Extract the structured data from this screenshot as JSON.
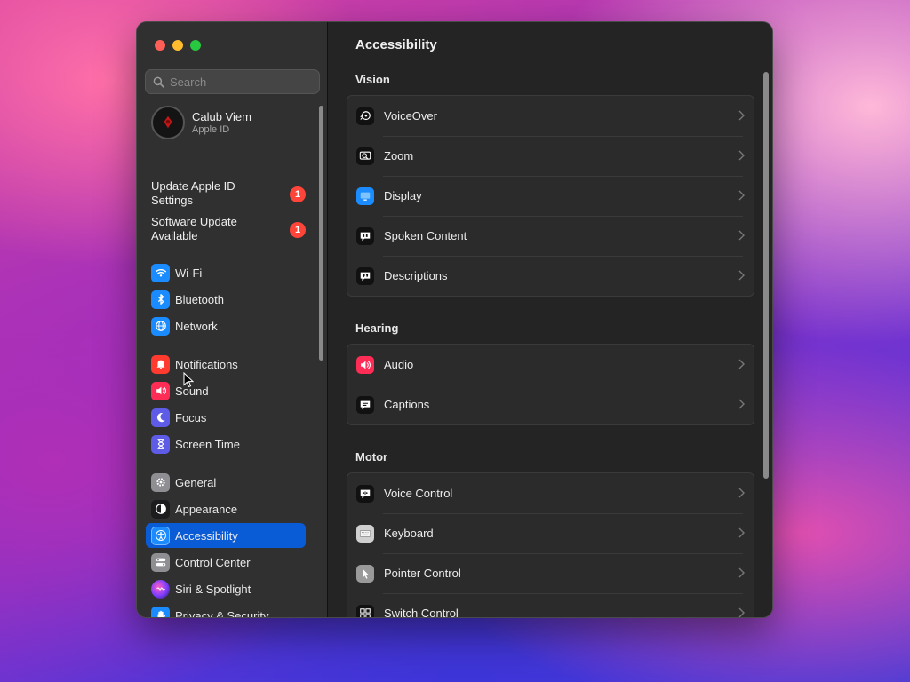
{
  "search": {
    "placeholder": "Search"
  },
  "account": {
    "name": "Calub Viem",
    "subtitle": "Apple ID"
  },
  "alerts": [
    {
      "label": "Update Apple ID Settings",
      "badge": "1"
    },
    {
      "label": "Software Update Available",
      "badge": "1"
    }
  ],
  "sidebar": {
    "items": [
      {
        "label": "Wi-Fi",
        "icon": "wifi-icon",
        "color": "#1a8cff"
      },
      {
        "label": "Bluetooth",
        "icon": "bluetooth-icon",
        "color": "#1a8cff"
      },
      {
        "label": "Network",
        "icon": "globe-icon",
        "color": "#1a8cff"
      },
      {
        "label": "Notifications",
        "icon": "bell-icon",
        "color": "#ff3b30"
      },
      {
        "label": "Sound",
        "icon": "speaker-icon",
        "color": "#ff2d55"
      },
      {
        "label": "Focus",
        "icon": "moon-icon",
        "color": "#5e5ce6"
      },
      {
        "label": "Screen Time",
        "icon": "hourglass-icon",
        "color": "#5e5ce6"
      },
      {
        "label": "General",
        "icon": "gear-icon",
        "color": "#8e8e93"
      },
      {
        "label": "Appearance",
        "icon": "appearance-icon",
        "color": "#1c1c1e"
      },
      {
        "label": "Accessibility",
        "icon": "accessibility-icon",
        "color": "#1a8cff",
        "selected": true
      },
      {
        "label": "Control Center",
        "icon": "toggles-icon",
        "color": "#8e8e93"
      },
      {
        "label": "Siri & Spotlight",
        "icon": "siri-icon",
        "color": "#bf5af2"
      },
      {
        "label": "Privacy & Security",
        "icon": "hand-icon",
        "color": "#1a8cff"
      }
    ]
  },
  "main": {
    "title": "Accessibility",
    "sections": [
      {
        "heading": "Vision",
        "rows": [
          {
            "label": "VoiceOver",
            "icon": "voiceover-icon"
          },
          {
            "label": "Zoom",
            "icon": "zoom-icon"
          },
          {
            "label": "Display",
            "icon": "display-icon"
          },
          {
            "label": "Spoken Content",
            "icon": "spoken-content-icon"
          },
          {
            "label": "Descriptions",
            "icon": "descriptions-icon"
          }
        ]
      },
      {
        "heading": "Hearing",
        "rows": [
          {
            "label": "Audio",
            "icon": "audio-icon"
          },
          {
            "label": "Captions",
            "icon": "captions-icon"
          }
        ]
      },
      {
        "heading": "Motor",
        "rows": [
          {
            "label": "Voice Control",
            "icon": "voice-control-icon"
          },
          {
            "label": "Keyboard",
            "icon": "keyboard-icon"
          },
          {
            "label": "Pointer Control",
            "icon": "pointer-control-icon"
          },
          {
            "label": "Switch Control",
            "icon": "switch-control-icon"
          }
        ]
      }
    ]
  }
}
